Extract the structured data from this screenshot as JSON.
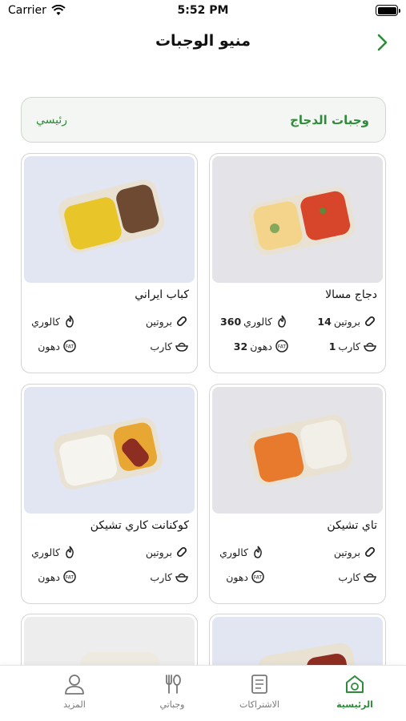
{
  "status": {
    "carrier": "Carrier",
    "time": "5:52 PM"
  },
  "nav": {
    "title": "منيو الوجبات"
  },
  "category": {
    "active": "وجبات الدجاج",
    "main": "رئيسي"
  },
  "labels": {
    "protein": "بروتين",
    "calories": "كالوري",
    "carbs": "كارب",
    "fat": "دهون"
  },
  "meals": [
    {
      "name": "دجاج مسالا",
      "protein": "14",
      "calories": "360",
      "carbs": "1",
      "fat": "32"
    },
    {
      "name": "كباب ايراني",
      "protein": "",
      "calories": "",
      "carbs": "",
      "fat": ""
    },
    {
      "name": "تاي تشيكن",
      "protein": "",
      "calories": "",
      "carbs": "",
      "fat": ""
    },
    {
      "name": "كوكنانت كاري تشيكن",
      "protein": "",
      "calories": "",
      "carbs": "",
      "fat": ""
    }
  ],
  "tabs": [
    {
      "label": "الرئيسية",
      "icon": "home-icon",
      "active": true
    },
    {
      "label": "الاشتراكات",
      "icon": "clipboard-icon",
      "active": false
    },
    {
      "label": "وجباتي",
      "icon": "fork-spoon-icon",
      "active": false
    },
    {
      "label": "المزيد",
      "icon": "person-icon",
      "active": false
    }
  ],
  "colors": {
    "accent": "#2e8b3a",
    "card_border": "#d4d4d4",
    "category_bg": "#f3f6f2"
  }
}
